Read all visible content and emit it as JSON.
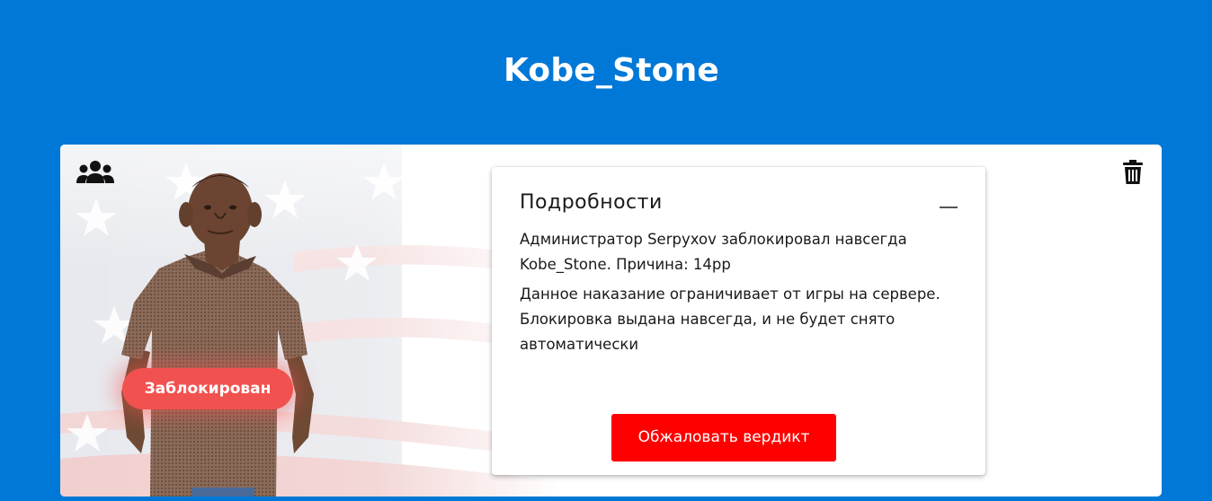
{
  "page": {
    "title": "Kobe_Stone"
  },
  "card": {
    "status_badge": "Заблокирован",
    "group_icon": "users-group-icon",
    "delete_icon": "trash-icon",
    "background": "us-flag-background",
    "details": {
      "heading": "Подробности",
      "collapse_icon": "minus-icon",
      "text_1": "Администратор Serpyxov заблокировал навсегда Kobe_Stone. Причина: 14pp",
      "text_2": "Данное наказание ограничивает от игры на сервере. Блокировка выдана навсегда, и не будет снято автоматически",
      "appeal_button": "Обжаловать вердикт"
    }
  },
  "colors": {
    "page_background": "#0078d7",
    "badge": "#f2524f",
    "button": "#ff0000"
  }
}
